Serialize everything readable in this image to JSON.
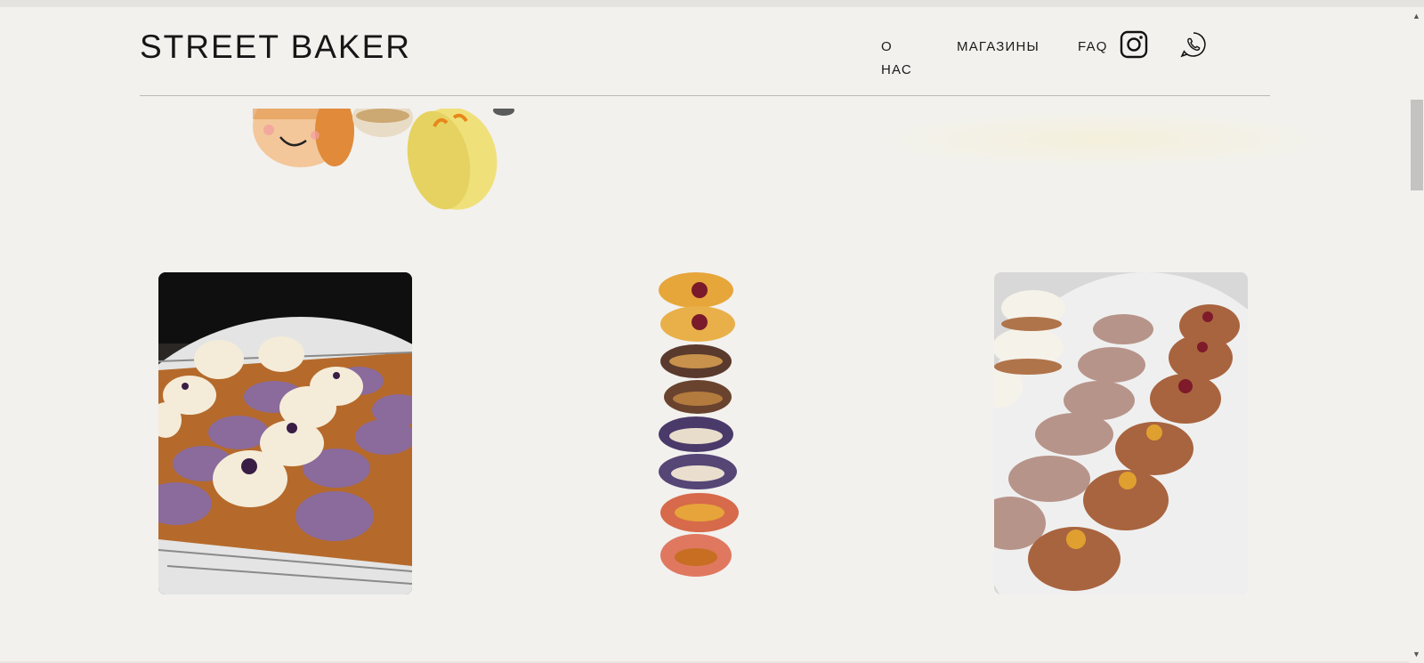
{
  "header": {
    "brand": "STREET BAKER",
    "nav": {
      "about": "О НАС",
      "shops": "МАГАЗИНЫ",
      "faq": "FAQ"
    },
    "icons": [
      "instagram-icon",
      "whatsapp-phone-icon"
    ]
  },
  "gallery": {
    "images": [
      "purple-macarons-on-rack",
      "stacked-macarons-cross-section",
      "chocolate-macarons-on-plate"
    ]
  },
  "colors": {
    "background": "#f2f1ee",
    "text": "#161616",
    "divider": "#b9b8b5"
  }
}
